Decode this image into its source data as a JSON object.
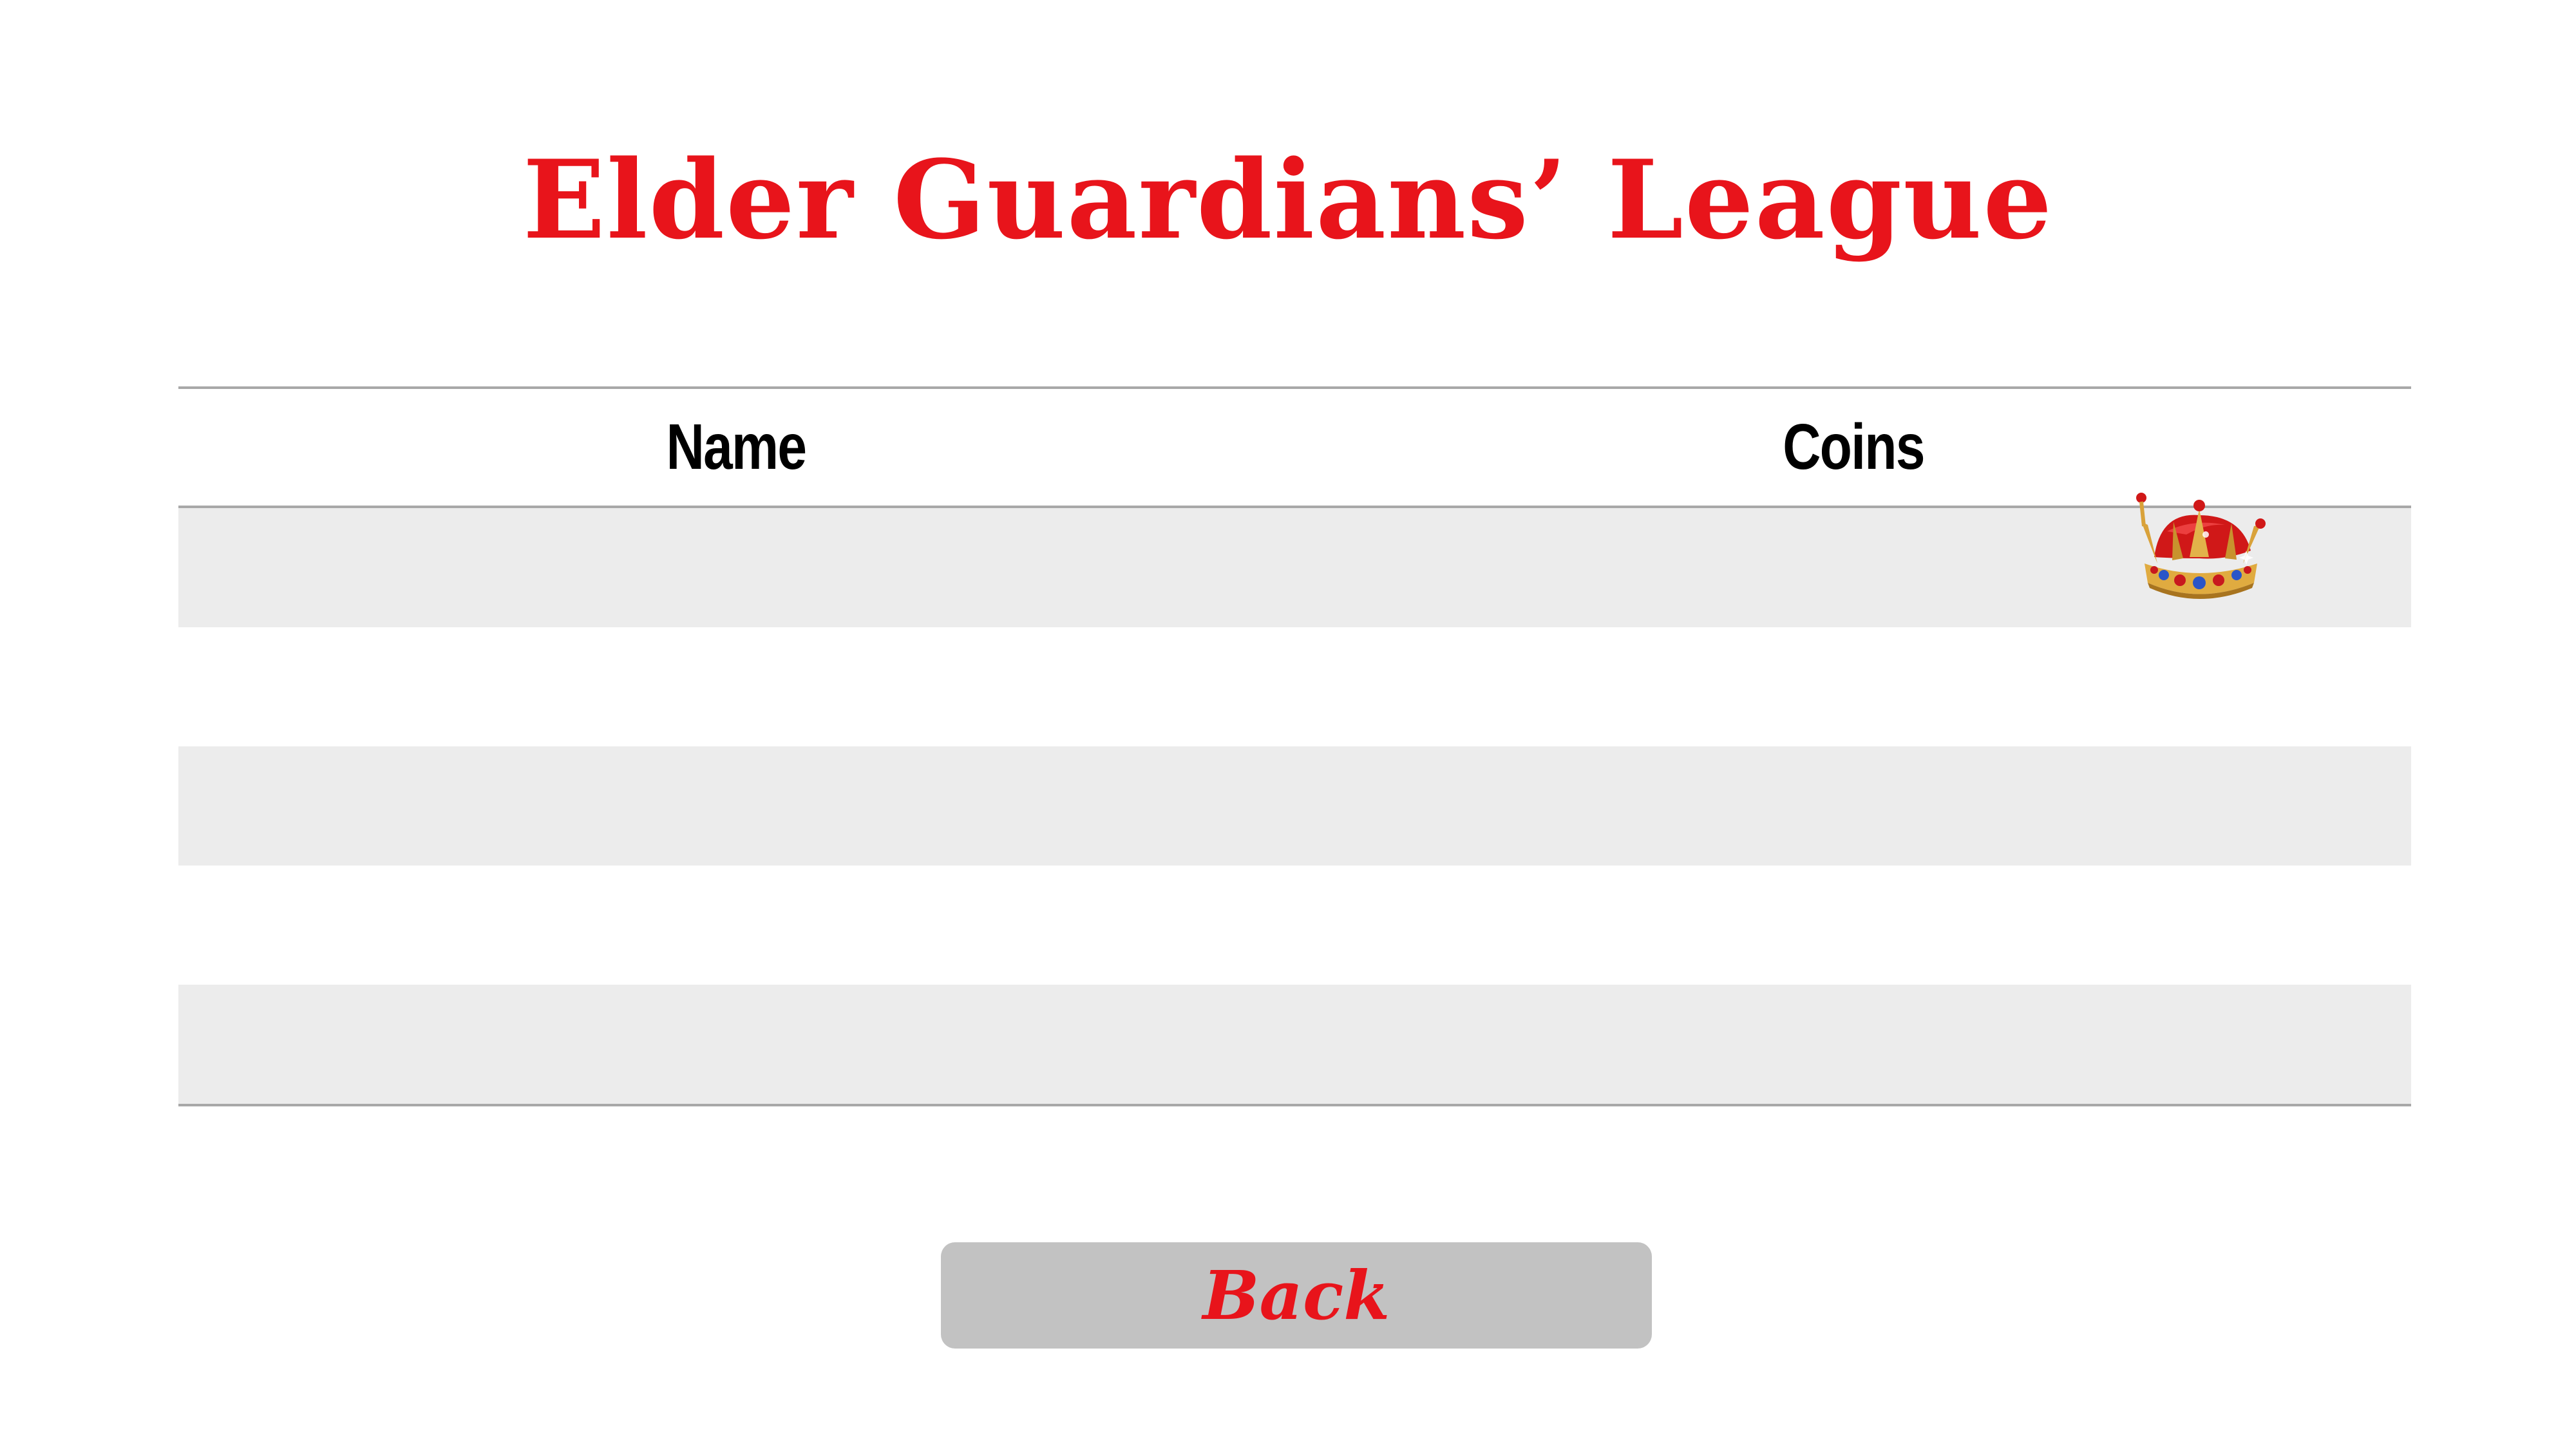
{
  "title": "Elder Guardians’ League",
  "table": {
    "headers": {
      "name": "Name",
      "coins": "Coins"
    },
    "rows": [
      {
        "name": "",
        "coins": ""
      },
      {
        "name": "",
        "coins": ""
      },
      {
        "name": "",
        "coins": ""
      },
      {
        "name": "",
        "coins": ""
      },
      {
        "name": "",
        "coins": ""
      }
    ]
  },
  "decoration": {
    "crown_icon": "crown-icon"
  },
  "back_button": {
    "label": "Back"
  },
  "colors": {
    "title": "#e8141b",
    "header_text": "#000000",
    "row_shade": "#ececec",
    "button_bg": "#c2c2c2",
    "button_text": "#e8141b"
  }
}
